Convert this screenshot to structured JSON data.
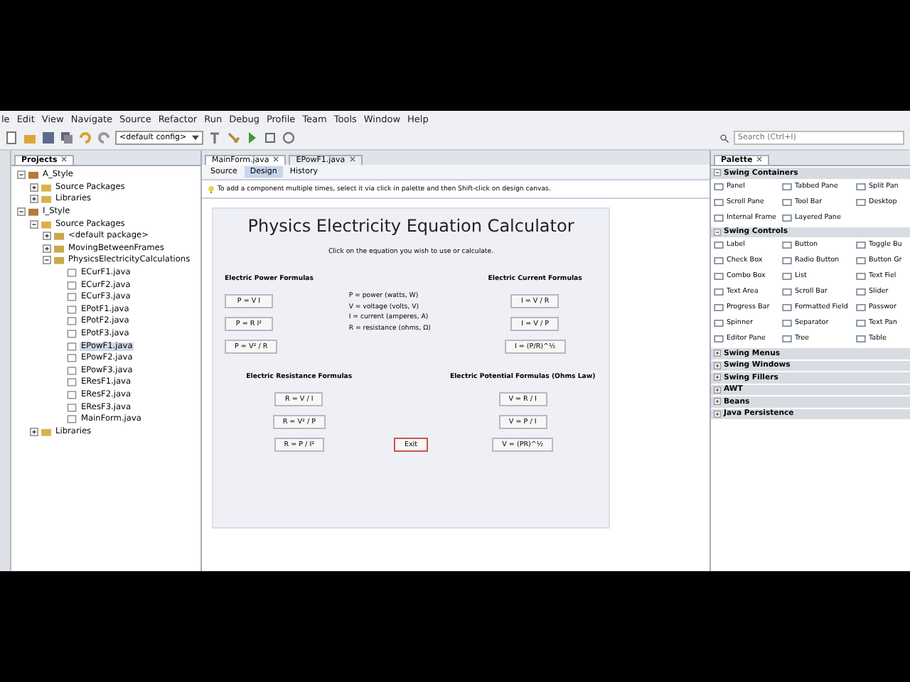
{
  "menu_bar": [
    "le",
    "Edit",
    "View",
    "Navigate",
    "Source",
    "Refactor",
    "Run",
    "Debug",
    "Profile",
    "Team",
    "Tools",
    "Window",
    "Help"
  ],
  "toolbar": {
    "config": "<default config>",
    "search": {
      "placeholder": "Search (Ctrl+I)"
    }
  },
  "projects_panel": {
    "title": "Projects",
    "tree": [
      {
        "label": "A_Style",
        "kind": "project",
        "expanded": true,
        "selected": false,
        "children": [
          {
            "label": "Source Packages",
            "kind": "folder",
            "expanded": false,
            "selected": false
          },
          {
            "label": "Libraries",
            "kind": "folder",
            "expanded": false,
            "selected": false
          }
        ]
      },
      {
        "label": "I_Style",
        "kind": "project",
        "expanded": true,
        "selected": false,
        "children": [
          {
            "label": "Source Packages",
            "kind": "folder",
            "expanded": true,
            "selected": false,
            "children": [
              {
                "label": "<default package>",
                "kind": "package",
                "expanded": false,
                "selected": false
              },
              {
                "label": "MovingBetweenFrames",
                "kind": "package",
                "expanded": false,
                "selected": false
              },
              {
                "label": "PhysicsElectricityCalculations",
                "kind": "package",
                "expanded": true,
                "selected": false,
                "children": [
                  {
                    "label": "ECurF1.java",
                    "kind": "file",
                    "selected": false
                  },
                  {
                    "label": "ECurF2.java",
                    "kind": "file",
                    "selected": false
                  },
                  {
                    "label": "ECurF3.java",
                    "kind": "file",
                    "selected": false
                  },
                  {
                    "label": "EPotF1.java",
                    "kind": "file",
                    "selected": false
                  },
                  {
                    "label": "EPotF2.java",
                    "kind": "file",
                    "selected": false
                  },
                  {
                    "label": "EPotF3.java",
                    "kind": "file",
                    "selected": false
                  },
                  {
                    "label": "EPowF1.java",
                    "kind": "file",
                    "selected": true
                  },
                  {
                    "label": "EPowF2.java",
                    "kind": "file",
                    "selected": false
                  },
                  {
                    "label": "EPowF3.java",
                    "kind": "file",
                    "selected": false
                  },
                  {
                    "label": "EResF1.java",
                    "kind": "file",
                    "selected": false
                  },
                  {
                    "label": "EResF2.java",
                    "kind": "file",
                    "selected": false
                  },
                  {
                    "label": "EResF3.java",
                    "kind": "file",
                    "selected": false
                  },
                  {
                    "label": "MainForm.java",
                    "kind": "file",
                    "selected": false
                  }
                ]
              }
            ]
          },
          {
            "label": "Libraries",
            "kind": "folder",
            "expanded": false,
            "selected": false
          }
        ]
      }
    ]
  },
  "editor": {
    "tabs": [
      {
        "label": "MainForm.java",
        "selected": true
      },
      {
        "label": "EPowF1.java",
        "selected": false
      }
    ],
    "view_tabs": [
      {
        "label": "Source",
        "selected": false
      },
      {
        "label": "Design",
        "selected": true
      },
      {
        "label": "History",
        "selected": false
      }
    ],
    "hint": "To add a component multiple times, select it via click in palette and then Shift-click on design canvas.",
    "form": {
      "title": "Physics Electricity Equation Calculator",
      "instruction": "Click on the equation you wish to use or calculate.",
      "power": {
        "heading": "Electric Power Formulas",
        "buttons": [
          "P = V I",
          "P = R I²",
          "P = V² / R"
        ]
      },
      "legend": [
        "P = power (watts, W)",
        "V = voltage (volts, V)",
        "I = current (amperes, A)",
        "R = resistance (ohms, Ω)"
      ],
      "current": {
        "heading": "Electric Current Formulas",
        "buttons": [
          "I = V / R",
          "I = V / P",
          "I = (P/R)^½"
        ]
      },
      "resistance": {
        "heading": "Electric Resistance Formulas",
        "buttons": [
          "R = V / I",
          "R = V² / P",
          "R = P / I²"
        ]
      },
      "potential": {
        "heading": "Electric Potential Formulas (Ohms Law)",
        "buttons": [
          "V = R / I",
          "V = P / I",
          "V = (PR)^½"
        ]
      },
      "exit": "Exit"
    }
  },
  "palette": {
    "title": "Palette",
    "categories": [
      {
        "label": "Swing Containers",
        "expanded": true,
        "items": [
          "Panel",
          "Tabbed Pane",
          "Split Pan",
          "Scroll Pane",
          "Tool Bar",
          "Desktop",
          "Internal Frame",
          "Layered Pane"
        ]
      },
      {
        "label": "Swing Controls",
        "expanded": true,
        "items": [
          "Label",
          "Button",
          "Toggle Bu",
          "Check Box",
          "Radio Button",
          "Button Gr",
          "Combo Box",
          "List",
          "Text Fiel",
          "Text Area",
          "Scroll Bar",
          "Slider",
          "Progress Bar",
          "Formatted Field",
          "Passwor",
          "Spinner",
          "Separator",
          "Text Pan",
          "Editor Pane",
          "Tree",
          "Table"
        ]
      },
      {
        "label": "Swing Menus",
        "expanded": false
      },
      {
        "label": "Swing Windows",
        "expanded": false
      },
      {
        "label": "Swing Fillers",
        "expanded": false
      },
      {
        "label": "AWT",
        "expanded": false
      },
      {
        "label": "Beans",
        "expanded": false
      },
      {
        "label": "Java Persistence",
        "expanded": false
      }
    ]
  }
}
